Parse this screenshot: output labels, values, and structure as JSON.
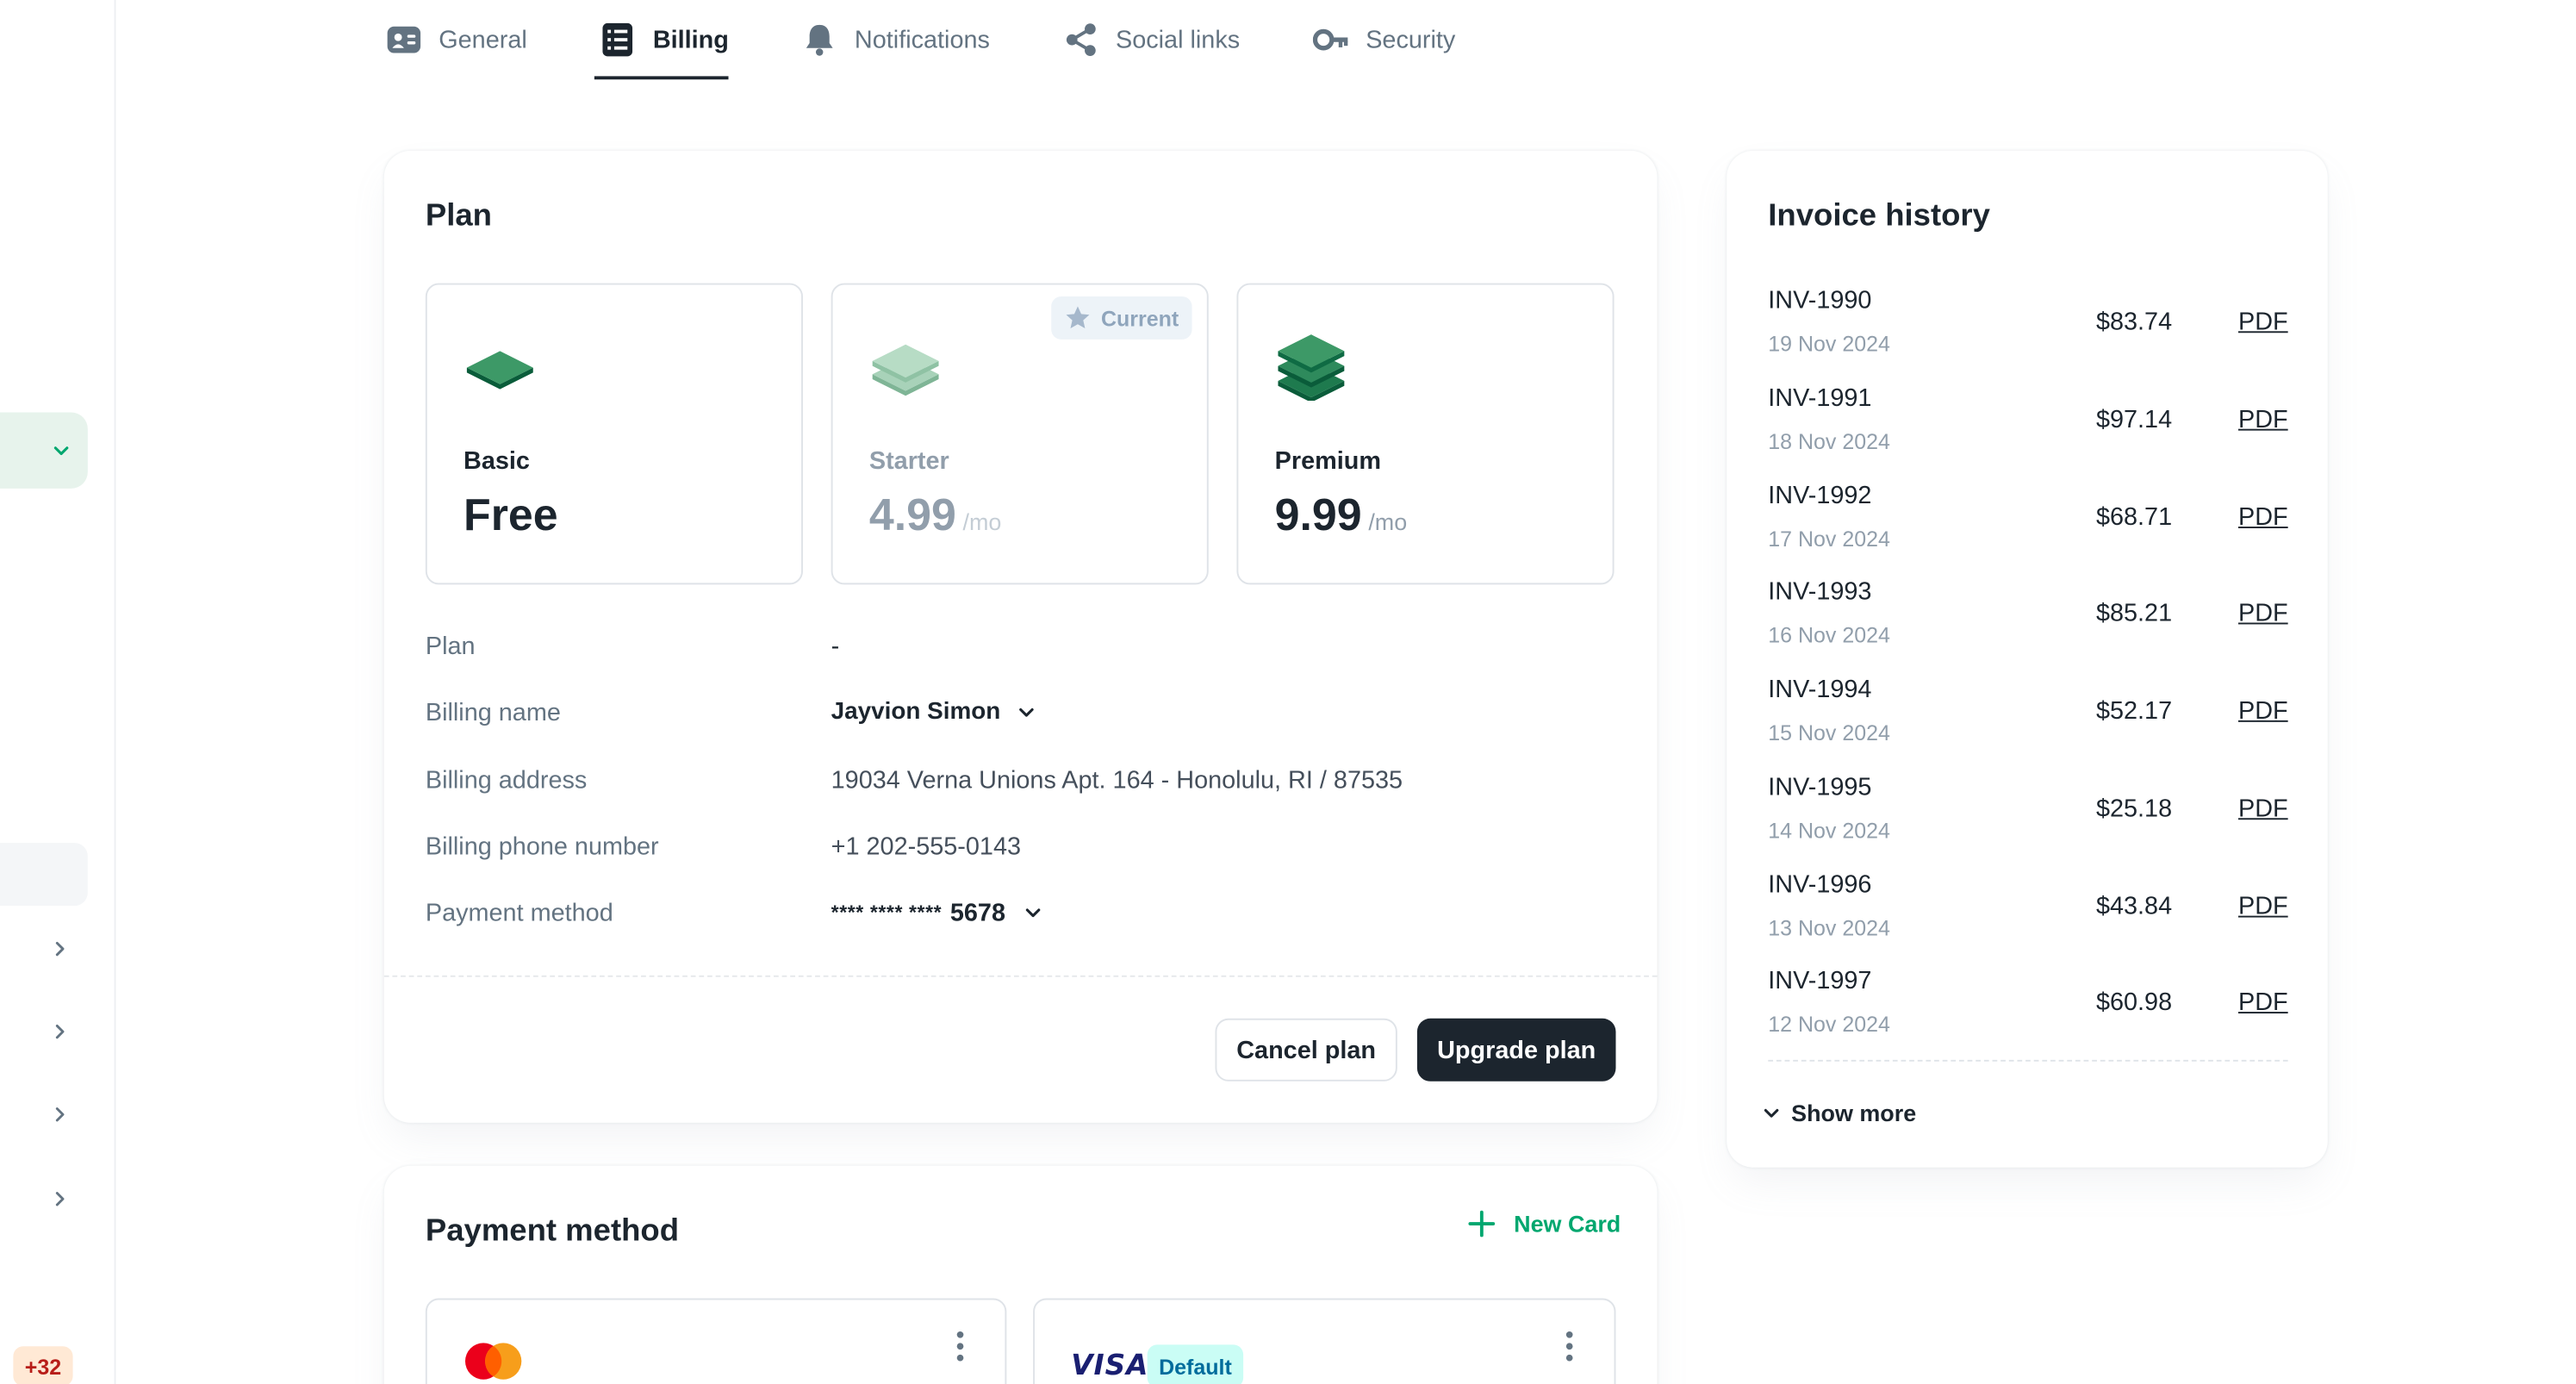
{
  "sidebar": {
    "badge_count": "+32"
  },
  "tabs": [
    {
      "label": "General",
      "icon": "id-card-icon",
      "active": false
    },
    {
      "label": "Billing",
      "icon": "bill-list-icon",
      "active": true
    },
    {
      "label": "Notifications",
      "icon": "bell-icon",
      "active": false
    },
    {
      "label": "Social links",
      "icon": "share-icon",
      "active": false
    },
    {
      "label": "Security",
      "icon": "key-icon",
      "active": false
    }
  ],
  "plan": {
    "title": "Plan",
    "tiers": [
      {
        "name": "Basic",
        "price": "Free",
        "period": "",
        "current": false
      },
      {
        "name": "Starter",
        "price": "4.99",
        "period": "/mo",
        "current": true
      },
      {
        "name": "Premium",
        "price": "9.99",
        "period": "/mo",
        "current": false
      }
    ],
    "current_label": "Current",
    "details": [
      {
        "label": "Plan",
        "value": "-"
      },
      {
        "label": "Billing name",
        "value": "Jayvion Simon"
      },
      {
        "label": "Billing address",
        "value": "19034 Verna Unions Apt. 164 - Honolulu, RI / 87535"
      },
      {
        "label": "Billing phone number",
        "value": "+1 202-555-0143"
      },
      {
        "label": "Payment method",
        "value_mask": "**** **** ****",
        "value": "5678"
      }
    ],
    "cancel_label": "Cancel plan",
    "upgrade_label": "Upgrade plan"
  },
  "payment": {
    "title": "Payment method",
    "new_card_label": "New Card",
    "cards": [
      {
        "brand": "mastercard",
        "default": false
      },
      {
        "brand": "VISA",
        "default": true,
        "default_label": "Default"
      }
    ]
  },
  "invoices": {
    "title": "Invoice history",
    "items": [
      {
        "id": "INV-1990",
        "date": "19 Nov 2024",
        "amount": "$83.74",
        "link": "PDF"
      },
      {
        "id": "INV-1991",
        "date": "18 Nov 2024",
        "amount": "$97.14",
        "link": "PDF"
      },
      {
        "id": "INV-1992",
        "date": "17 Nov 2024",
        "amount": "$68.71",
        "link": "PDF"
      },
      {
        "id": "INV-1993",
        "date": "16 Nov 2024",
        "amount": "$85.21",
        "link": "PDF"
      },
      {
        "id": "INV-1994",
        "date": "15 Nov 2024",
        "amount": "$52.17",
        "link": "PDF"
      },
      {
        "id": "INV-1995",
        "date": "14 Nov 2024",
        "amount": "$25.18",
        "link": "PDF"
      },
      {
        "id": "INV-1996",
        "date": "13 Nov 2024",
        "amount": "$43.84",
        "link": "PDF"
      },
      {
        "id": "INV-1997",
        "date": "12 Nov 2024",
        "amount": "$60.98",
        "link": "PDF"
      }
    ],
    "show_more_label": "Show more"
  },
  "colors": {
    "accent": "#00A76F",
    "dark": "#1C252E",
    "muted": "#637381"
  }
}
